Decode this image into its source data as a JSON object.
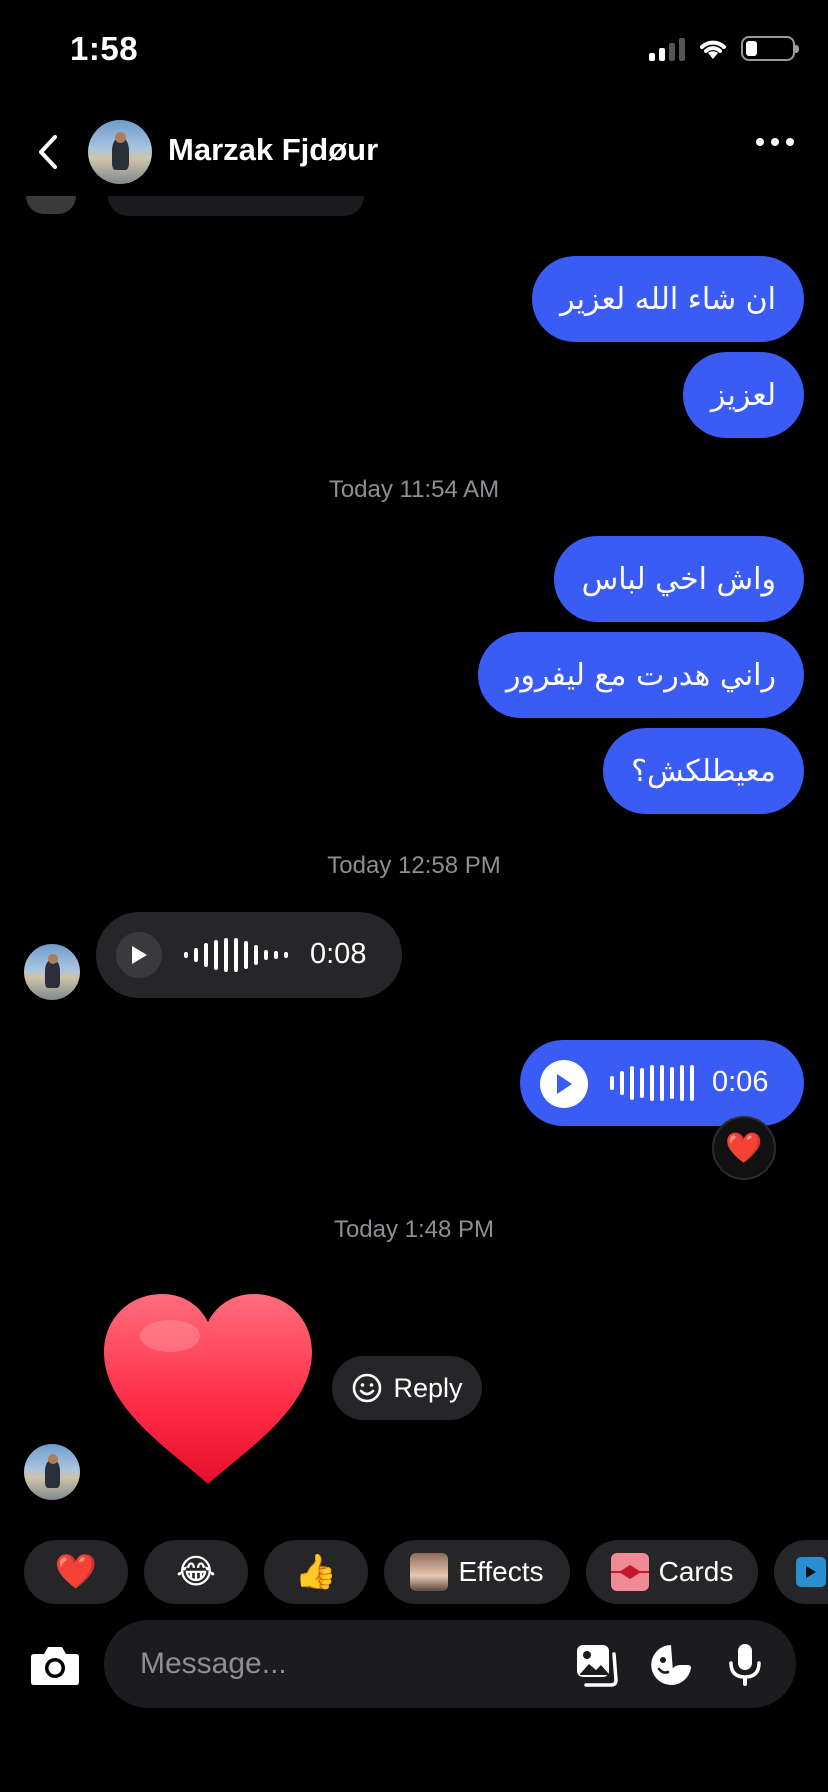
{
  "status": {
    "time": "1:58"
  },
  "header": {
    "contact_name": "Marzak Fjdøur"
  },
  "messages": {
    "out_1": "ان شاء الله لعزير",
    "out_2": "لعزيز",
    "ts_1": "Today 11:54 AM",
    "out_3": "واش اخي لباس",
    "out_4": "راني هدرت مع ليفرور",
    "out_5": "معيطلكش؟",
    "ts_2": "Today 12:58 PM",
    "voice_in_duration": "0:08",
    "voice_out_duration": "0:06",
    "voice_out_reaction": "❤️",
    "ts_3": "Today 1:48 PM",
    "reply_label": "Reply"
  },
  "quick_actions": {
    "heart": "❤️",
    "laugh": "😂",
    "thumbs": "👍",
    "effects": "Effects",
    "cards": "Cards"
  },
  "composer": {
    "placeholder": "Message..."
  },
  "colors": {
    "outgoing_bubble": "#3a5cf5",
    "incoming_bubble": "#262628",
    "background": "#000000"
  }
}
